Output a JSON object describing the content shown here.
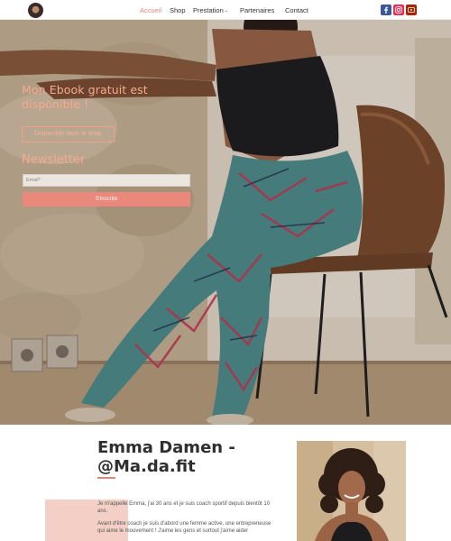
{
  "header": {
    "nav": [
      {
        "label": "Accueil",
        "active": true
      },
      {
        "label": "Shop",
        "active": false
      },
      {
        "label": "Prestation",
        "active": false,
        "has_dropdown": true
      },
      {
        "label": "Partenaires",
        "active": false
      },
      {
        "label": "Contact",
        "active": false
      }
    ],
    "dropdown_glyph": "⌄",
    "social": [
      {
        "name": "facebook-icon",
        "color": "#3b5998"
      },
      {
        "name": "instagram-icon",
        "color": "#ea2c59"
      },
      {
        "name": "youtube-icon",
        "color": "#a82400"
      }
    ],
    "accent_color": "#e3867a"
  },
  "hero": {
    "ebook_title": "Mon Ebook gratuit est disponible !",
    "ebook_button": "Disponible dans le shop",
    "newsletter_title": "Newsletter",
    "email_placeholder": "Email*",
    "email_value": "",
    "submit_label": "S'inscrire"
  },
  "about": {
    "title": "Emma Damen - @Ma.da.fit",
    "paragraphs": [
      "Je m'appelle Emma, j'ai 30 ans et je suis coach sportif depuis bientôt 10 ans.",
      "Avant d'être coach je suis d'abord une femme active, une entrepreneuse qui aime le mouvement ! J'aime les gens et surtout j'aime aider"
    ]
  }
}
